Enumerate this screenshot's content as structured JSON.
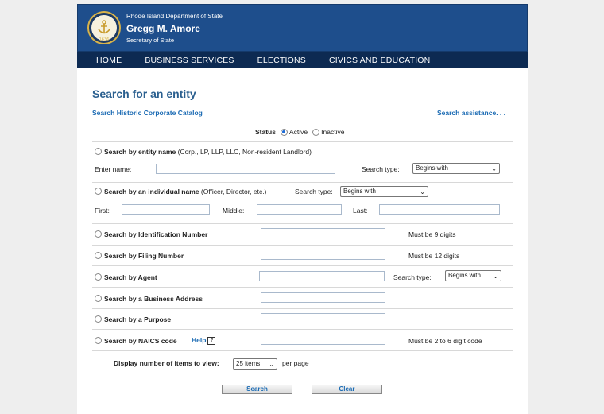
{
  "header": {
    "department": "Rhode Island Department of State",
    "name": "Gregg M. Amore",
    "secretary": "Secretary of State",
    "seal_year": "1636"
  },
  "nav": [
    "HOME",
    "BUSINESS SERVICES",
    "ELECTIONS",
    "CIVICS AND EDUCATION"
  ],
  "title": "Search for an entity",
  "links": {
    "historic": "Search Historic Corporate Catalog",
    "assistance": "Search assistance. . ."
  },
  "status": {
    "label": "Status",
    "active": "Active",
    "inactive": "Inactive",
    "selected": "Active"
  },
  "entity": {
    "label": "Search by entity name",
    "note": "(Corp., LP, LLP, LLC, Non-resident Landlord)",
    "enter_name": "Enter name:",
    "search_type_label": "Search type:",
    "search_type": "Begins with"
  },
  "individual": {
    "label": "Search by an individual name",
    "note": "(Officer, Director, etc.)",
    "search_type_label": "Search type:",
    "search_type": "Begins with",
    "first": "First:",
    "middle": "Middle:",
    "last": "Last:"
  },
  "id_number": {
    "label": "Search by Identification Number",
    "hint": "Must be 9 digits"
  },
  "filing": {
    "label": "Search by Filing Number",
    "hint": "Must be 12 digits"
  },
  "agent": {
    "label": "Search by Agent",
    "search_type_label": "Search type:",
    "search_type": "Begins with"
  },
  "address": {
    "label": "Search by a Business Address"
  },
  "purpose": {
    "label": "Search by a Purpose"
  },
  "naics": {
    "label": "Search by NAICS code",
    "help": "Help",
    "help_icon": "?",
    "hint": "Must be 2 to 6 digit code"
  },
  "display": {
    "label": "Display number of items to view:",
    "value": "25 items",
    "suffix": "per page"
  },
  "buttons": {
    "search": "Search",
    "clear": "Clear"
  }
}
